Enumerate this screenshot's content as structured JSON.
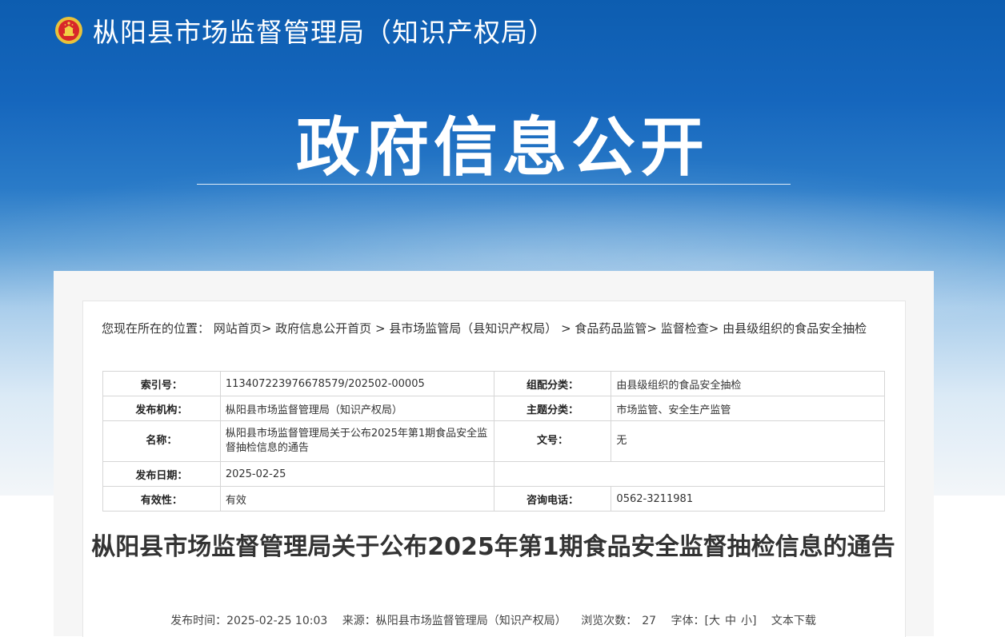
{
  "site": {
    "title": "枞阳县市场监督管理局（知识产权局）",
    "emblem_icon": "national-emblem-icon"
  },
  "hero": {
    "title": "政府信息公开"
  },
  "breadcrumb": {
    "prefix": "您现在所在的位置：",
    "items": [
      "网站首页",
      "政府信息公开首页",
      "县市场监管局（县知识产权局）",
      "食品药品监管",
      "监督检查",
      "由县级组织的食品安全抽检"
    ],
    "separators": [
      "> ",
      " > ",
      " > ",
      "> ",
      "> "
    ]
  },
  "info": {
    "index_label": "索引号：",
    "index_value": "113407223976678579/202502-00005",
    "category_label": "组配分类：",
    "category_value": "由县级组织的食品安全抽检",
    "publisher_label": "发布机构：",
    "publisher_value": "枞阳县市场监督管理局（知识产权局）",
    "topic_label": "主题分类：",
    "topic_value": "市场监管、安全生产监管",
    "name_label": "名称：",
    "name_value": "枞阳县市场监督管理局关于公布2025年第1期食品安全监督抽检信息的通告",
    "docno_label": "文号：",
    "docno_value": "无",
    "date_label": "发布日期：",
    "date_value": "2025-02-25",
    "validity_label": "有效性：",
    "validity_value": "有效",
    "phone_label": "咨询电话：",
    "phone_value": "0562-3211981"
  },
  "article": {
    "title": "枞阳县市场监督管理局关于公布2025年第1期食品安全监督抽检信息的通告",
    "publish_time": "发布时间：2025-02-25 10:03",
    "source": "来源：枞阳县市场监督管理局（知识产权局）",
    "views_label": "浏览次数：",
    "views_count": "27",
    "font_label": "字体：[",
    "font_large": "大",
    "font_medium": "中",
    "font_small": "小",
    "font_close": "]",
    "download": "文本下载"
  }
}
